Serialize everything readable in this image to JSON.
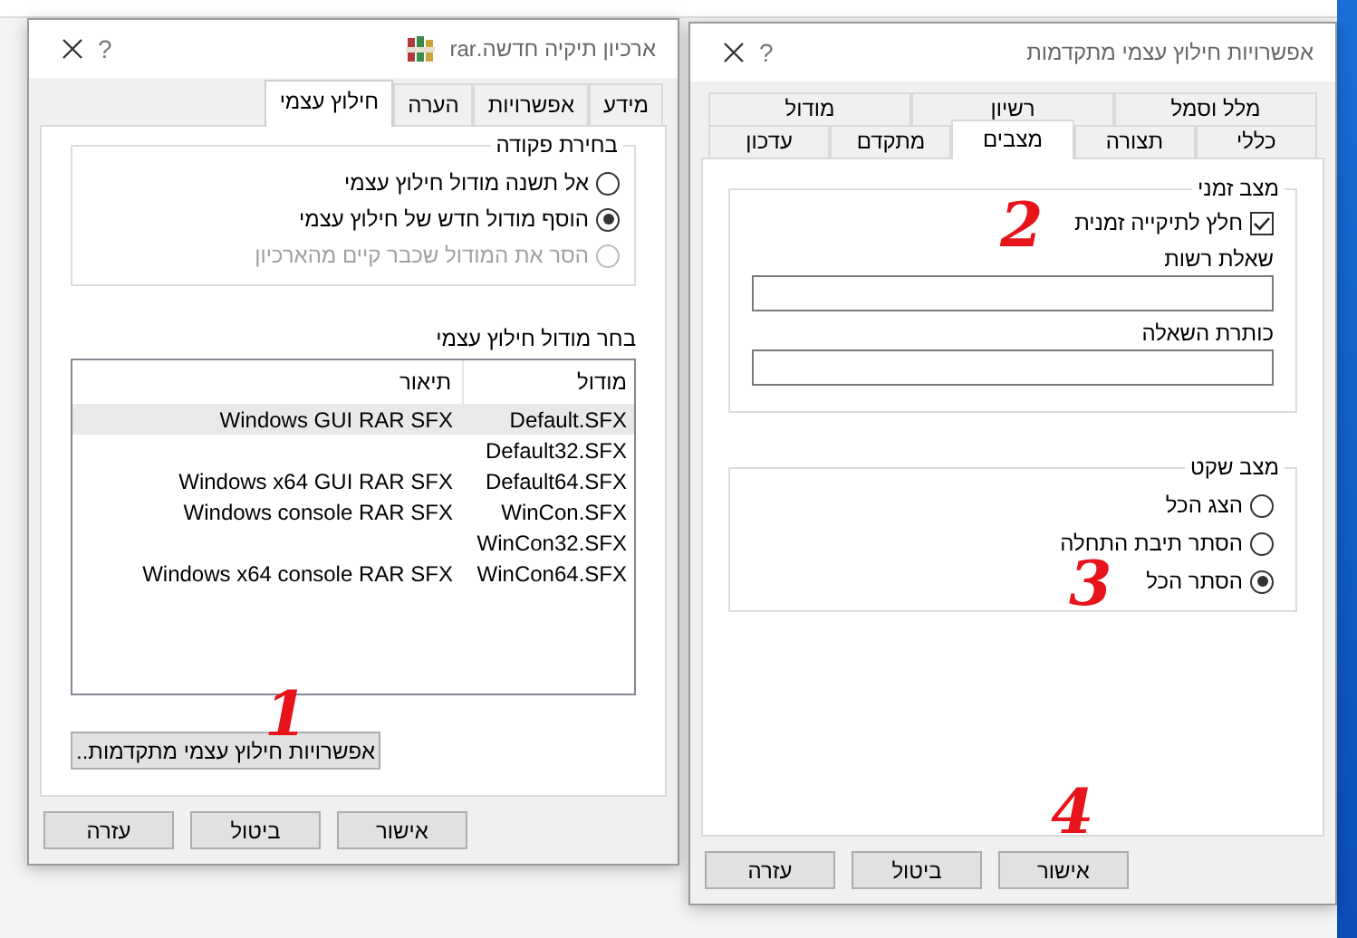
{
  "left_dialog": {
    "title": "ארכיון תיקיה חדשה.rar",
    "help": "?",
    "tabs": [
      {
        "label": "מידע",
        "selected": false
      },
      {
        "label": "אפשרויות",
        "selected": false
      },
      {
        "label": "הערה",
        "selected": false
      },
      {
        "label": "חילוץ עצמי",
        "selected": true
      }
    ],
    "command_group": {
      "title": "בחירת פקודה",
      "options": [
        {
          "label": "אל תשנה מודול חילוץ עצמי",
          "selected": false,
          "disabled": false
        },
        {
          "label": "הוסף מודול חדש של חילוץ עצמי",
          "selected": true,
          "disabled": false
        },
        {
          "label": "הסר את המודול שכבר קיים מהארכיון",
          "selected": false,
          "disabled": true
        }
      ]
    },
    "module_label": "בחר מודול חילוץ עצמי",
    "module_table": {
      "columns": [
        "מודול",
        "תיאור"
      ],
      "rows": [
        {
          "cells": [
            "Default.SFX",
            "Windows GUI RAR SFX"
          ],
          "selected": true
        },
        {
          "cells": [
            "Default32.SFX",
            ""
          ],
          "selected": false
        },
        {
          "cells": [
            "Default64.SFX",
            "Windows x64 GUI RAR SFX"
          ],
          "selected": false
        },
        {
          "cells": [
            "WinCon.SFX",
            "Windows console RAR SFX"
          ],
          "selected": false
        },
        {
          "cells": [
            "WinCon32.SFX",
            ""
          ],
          "selected": false
        },
        {
          "cells": [
            "WinCon64.SFX",
            "Windows x64 console RAR SFX"
          ],
          "selected": false
        }
      ]
    },
    "advanced_button": "אפשרויות חילוץ עצמי מתקדמות..",
    "buttons": [
      "אישור",
      "ביטול",
      "עזרה"
    ]
  },
  "right_dialog": {
    "title": "אפשרויות חילוץ עצמי מתקדמות",
    "help": "?",
    "tab_rows": [
      [
        {
          "label": "מלל וסמל",
          "selected": false
        },
        {
          "label": "רשיון",
          "selected": false
        },
        {
          "label": "מודול",
          "selected": false
        }
      ],
      [
        {
          "label": "כללי",
          "selected": false
        },
        {
          "label": "תצורה",
          "selected": false
        },
        {
          "label": "מצבים",
          "selected": true
        },
        {
          "label": "מתקדם",
          "selected": false
        },
        {
          "label": "עדכון",
          "selected": false
        }
      ]
    ],
    "temp_group": {
      "title": "מצב זמני",
      "checkbox": {
        "label": "חלץ לתיקייה זמנית",
        "checked": true
      },
      "fields": [
        {
          "label": "שאלת רשות"
        },
        {
          "label": "כותרת השאלה"
        }
      ]
    },
    "silent_group": {
      "title": "מצב שקט",
      "options": [
        {
          "label": "הצג הכל",
          "selected": false
        },
        {
          "label": "הסתר תיבת התחלה",
          "selected": false
        },
        {
          "label": "הסתר הכל",
          "selected": true
        }
      ]
    },
    "buttons": [
      "אישור",
      "ביטול",
      "עזרה"
    ]
  },
  "annotations": [
    {
      "text": "1"
    },
    {
      "text": "2"
    },
    {
      "text": "3"
    },
    {
      "text": "4"
    }
  ]
}
